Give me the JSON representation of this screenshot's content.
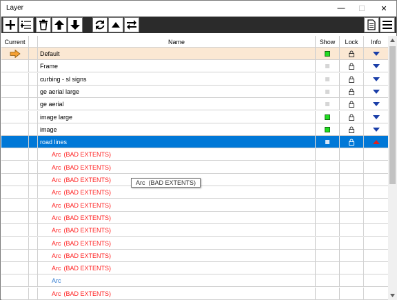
{
  "window": {
    "title": "Layer",
    "min_glyph": "—",
    "max_glyph": "☐",
    "close_glyph": "✕"
  },
  "toolbar": {
    "buttons": [
      {
        "name": "add-layer-button",
        "icon": "plus-icon"
      },
      {
        "name": "layer-list-button",
        "icon": "list-icon"
      },
      {
        "name": "delete-layer-button",
        "icon": "trash-icon"
      },
      {
        "name": "move-up-button",
        "icon": "arrow-up-icon"
      },
      {
        "name": "move-down-button",
        "icon": "arrow-down-icon"
      },
      {
        "name": "refresh-button",
        "icon": "refresh-icon"
      },
      {
        "name": "collapse-button",
        "icon": "triangle-up-icon"
      },
      {
        "name": "swap-button",
        "icon": "swap-icon"
      },
      {
        "name": "document-button",
        "icon": "document-icon"
      },
      {
        "name": "menu-button",
        "icon": "hamburger-icon"
      }
    ]
  },
  "columns": {
    "current": "Current",
    "name": "Name",
    "show": "Show",
    "lock": "Lock",
    "info": "Info"
  },
  "layers": [
    {
      "name": "Default",
      "current": true,
      "show": "green",
      "info": "down"
    },
    {
      "name": "Frame",
      "show": "gray",
      "info": "down"
    },
    {
      "name": "curbing - sl signs",
      "show": "gray",
      "info": "down"
    },
    {
      "name": "ge aerial large",
      "show": "gray",
      "info": "down"
    },
    {
      "name": "ge aerial",
      "show": "gray",
      "info": "down"
    },
    {
      "name": "image large",
      "show": "green",
      "info": "down"
    },
    {
      "name": "image",
      "show": "green",
      "info": "down"
    },
    {
      "name": "road lines",
      "show": "gray",
      "info": "up",
      "selected": true
    }
  ],
  "entities": [
    {
      "type": "Arc",
      "status": "(BAD EXTENTS)"
    },
    {
      "type": "Arc",
      "status": "(BAD EXTENTS)"
    },
    {
      "type": "Arc",
      "status": "(BAD EXTENTS)"
    },
    {
      "type": "Arc",
      "status": "(BAD EXTENTS)"
    },
    {
      "type": "Arc",
      "status": "(BAD EXTENTS)"
    },
    {
      "type": "Arc",
      "status": "(BAD EXTENTS)"
    },
    {
      "type": "Arc",
      "status": "(BAD EXTENTS)"
    },
    {
      "type": "Arc",
      "status": "(BAD EXTENTS)"
    },
    {
      "type": "Arc",
      "status": "(BAD EXTENTS)"
    },
    {
      "type": "Arc",
      "status": "(BAD EXTENTS)"
    },
    {
      "type": "Arc",
      "status": ""
    },
    {
      "type": "Arc",
      "status": "(BAD EXTENTS)"
    }
  ],
  "tooltip": {
    "text": "Arc  (BAD EXTENTS)"
  },
  "colors": {
    "current_row": "#fbe8d3",
    "selected_row": "#0078d7",
    "bad_text": "#ff2222",
    "ok_text": "#2f7ad0",
    "show_on": "#22dd22",
    "info_arrow_down": "#1a3ea8",
    "info_arrow_up": "#e0201c",
    "current_arrow": "#f5a033"
  }
}
